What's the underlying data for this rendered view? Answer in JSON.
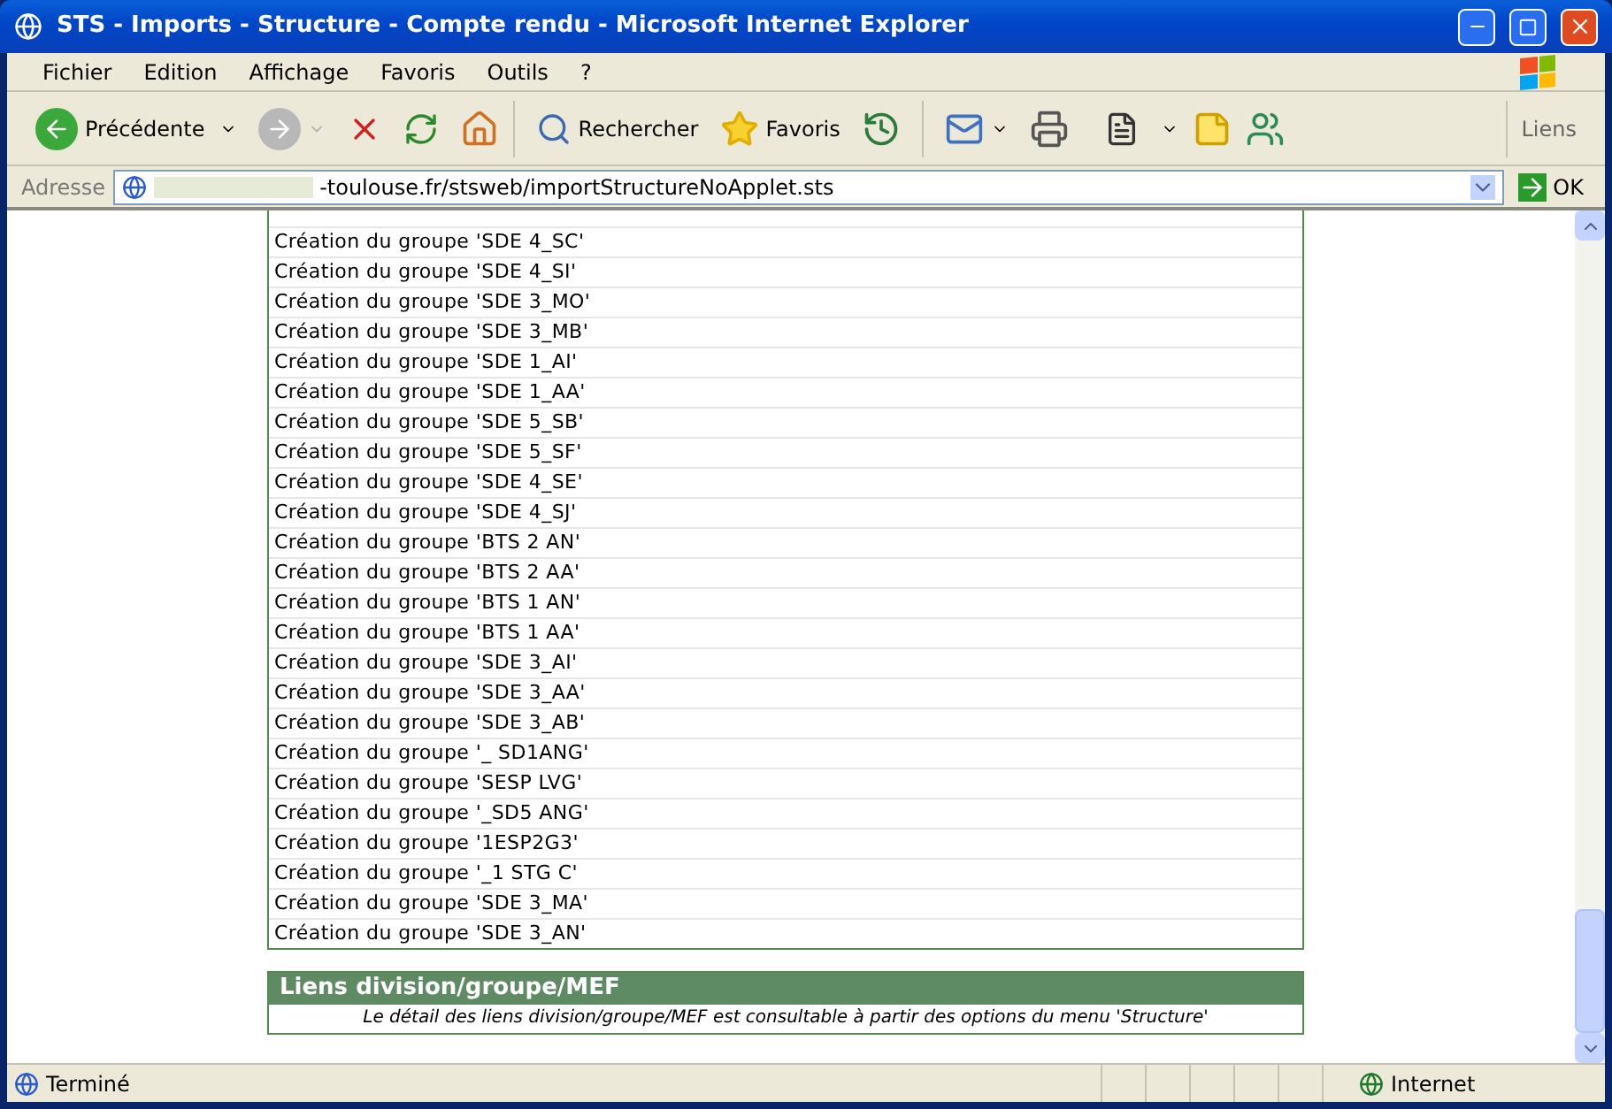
{
  "window": {
    "title": "STS - Imports - Structure - Compte rendu - Microsoft Internet Explorer"
  },
  "menu": [
    "Fichier",
    "Edition",
    "Affichage",
    "Favoris",
    "Outils",
    "?"
  ],
  "toolbar": {
    "back": "Précédente",
    "search": "Rechercher",
    "favorites": "Favoris",
    "links": "Liens"
  },
  "address": {
    "label": "Adresse",
    "value": "-toulouse.fr/stsweb/importStructureNoApplet.sts",
    "go": "OK"
  },
  "log": {
    "rows": [
      "Création du groupe 'SDE 4_SC'",
      "Création du groupe 'SDE 4_SI'",
      "Création du groupe 'SDE 3_MO'",
      "Création du groupe 'SDE 3_MB'",
      "Création du groupe 'SDE 1_AI'",
      "Création du groupe 'SDE 1_AA'",
      "Création du groupe 'SDE 5_SB'",
      "Création du groupe 'SDE 5_SF'",
      "Création du groupe 'SDE 4_SE'",
      "Création du groupe 'SDE 4_SJ'",
      "Création du groupe 'BTS 2 AN'",
      "Création du groupe 'BTS 2 AA'",
      "Création du groupe 'BTS 1 AN'",
      "Création du groupe 'BTS 1 AA'",
      "Création du groupe 'SDE 3_AI'",
      "Création du groupe 'SDE 3_AA'",
      "Création du groupe 'SDE 3_AB'",
      "Création du groupe '_ SD1ANG'",
      "Création du groupe 'SESP LVG'",
      "Création du groupe '_SD5 ANG'",
      "Création du groupe '1ESP2G3'",
      "Création du groupe '_1 STG C'",
      "Création du groupe 'SDE 3_MA'",
      "Création du groupe 'SDE 3_AN'"
    ]
  },
  "section": {
    "title": "Liens division/groupe/MEF",
    "note": "Le détail des liens division/groupe/MEF est consultable à partir des options du menu 'Structure'"
  },
  "status_bar": {
    "text": "Terminé",
    "zone": "Internet"
  }
}
